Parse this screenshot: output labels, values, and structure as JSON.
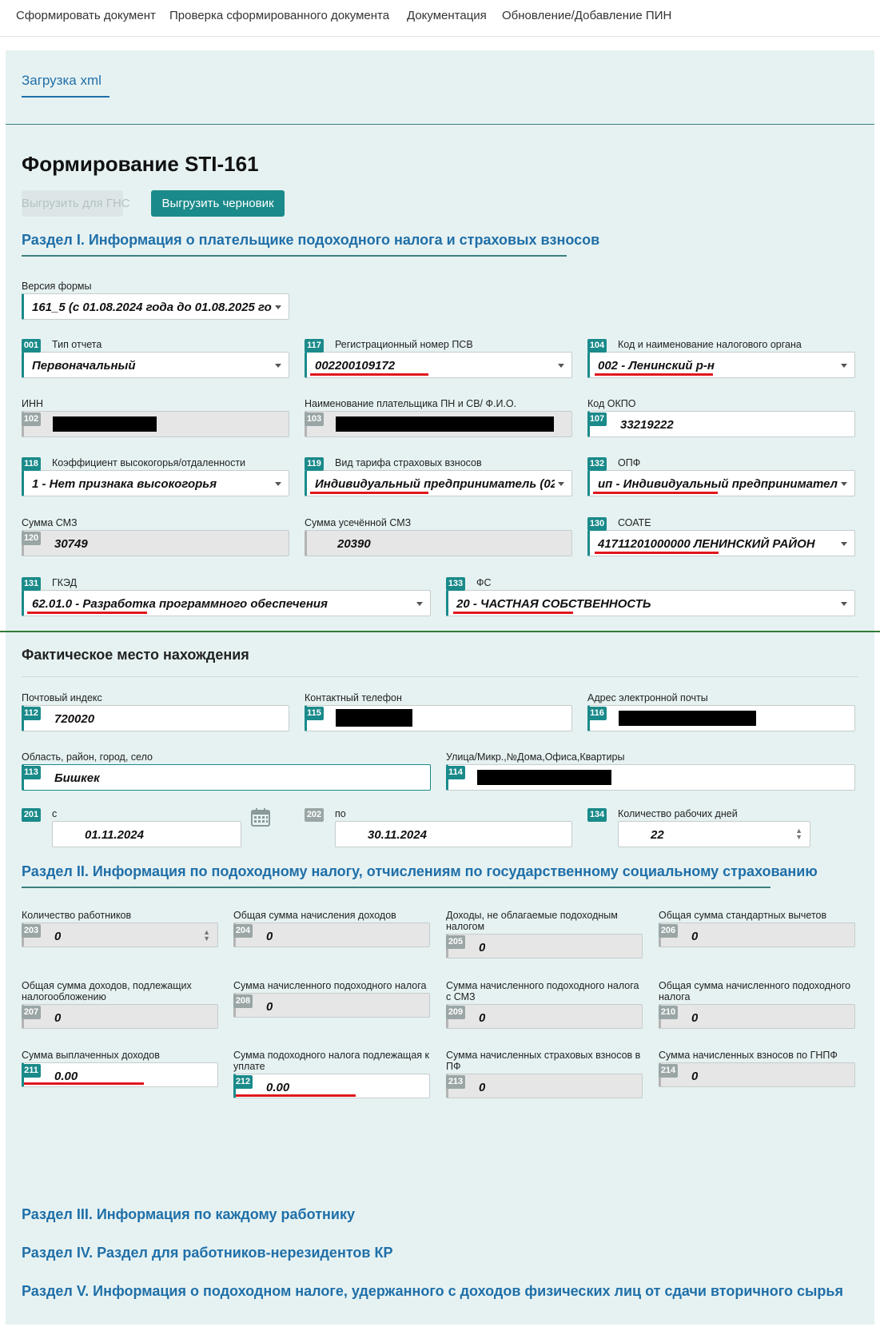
{
  "nav": {
    "items": [
      "Сформировать документ",
      "Проверка сформированного документа",
      "Документация",
      "Обновление/Добавление ПИН"
    ]
  },
  "tab": {
    "label": "Загрузка xml"
  },
  "page": {
    "title": "Формирование STI-161"
  },
  "buttons": {
    "ghns": "Выгрузить для ГНС",
    "draft": "Выгрузить черновик"
  },
  "section1": {
    "title": "Раздел I. Информация о плательщике подоходного налога и страховых взносов",
    "form_version": {
      "label": "Версия формы",
      "value": "161_5 (с 01.08.2024 года до 01.08.2025 го..."
    },
    "f001": {
      "code": "001",
      "label": "Тип отчета",
      "value": "Первоначальный"
    },
    "f117": {
      "code": "117",
      "label": "Регистрационный номер ПСВ",
      "value": "002200109172"
    },
    "f104": {
      "code": "104",
      "label": "Код и наименование налогового органа",
      "value": "002 - Ленинский р-н"
    },
    "f102": {
      "code": "102",
      "label": "ИНН"
    },
    "f103": {
      "code": "103",
      "label": "Наименование плательщика ПН и СВ/ Ф.И.О."
    },
    "f107": {
      "code": "107",
      "label": "Код ОКПО",
      "value": "33219222"
    },
    "f118": {
      "code": "118",
      "label": "Коэффициент высокогорья/отдаленности",
      "value": "1 - Нет признака высокогорья"
    },
    "f119": {
      "code": "119",
      "label": "Вид тарифа страховых взносов",
      "value": "Индивидуальный предприниматель (02.0..."
    },
    "f132": {
      "code": "132",
      "label": "ОПФ",
      "value": "ип - Индивидуальный предприниматель"
    },
    "f120": {
      "code": "120",
      "label": "Сумма СМЗ",
      "value": "30749"
    },
    "f121": {
      "label": "Сумма усечённой СМЗ",
      "value": "20390"
    },
    "f130": {
      "code": "130",
      "label": "СОАТЕ",
      "value": "41711201000000 ЛЕНИНСКИЙ РАЙОН"
    },
    "f131": {
      "code": "131",
      "label": "ГКЭД",
      "value": "62.01.0 - Разработка программного обеспечения"
    },
    "f133": {
      "code": "133",
      "label": "ФС",
      "value": "20 - ЧАСТНАЯ СОБСТВЕННОСТЬ"
    }
  },
  "location": {
    "title": "Фактическое место нахождения",
    "f112": {
      "code": "112",
      "label": "Почтовый индекс",
      "value": "720020"
    },
    "f115": {
      "code": "115",
      "label": "Контактный телефон"
    },
    "f116": {
      "code": "116",
      "label": "Адрес электронной почты"
    },
    "f113": {
      "code": "113",
      "label": "Область, район, город, село",
      "value": "Бишкек"
    },
    "f114": {
      "code": "114",
      "label": "Улица/Микр.,№Дома,Офиса,Квартиры"
    },
    "f201": {
      "code": "201",
      "label": "с",
      "value": "01.11.2024"
    },
    "f202": {
      "code": "202",
      "label": "по",
      "value": "30.11.2024"
    },
    "f134": {
      "code": "134",
      "label": "Количество рабочих дней",
      "value": "22"
    }
  },
  "section2": {
    "title": "Раздел II. Информация по подоходному налогу, отчислениям по государственному социальному страхованию",
    "f203": {
      "code": "203",
      "label": "Количество работников",
      "value": "0"
    },
    "f204": {
      "code": "204",
      "label": "Общая сумма начисления доходов",
      "value": "0"
    },
    "f205": {
      "code": "205",
      "label": "Доходы, не облагаемые подоходным налогом",
      "value": "0"
    },
    "f206": {
      "code": "206",
      "label": "Общая сумма стандартных вычетов",
      "value": "0"
    },
    "f207": {
      "code": "207",
      "label": "Общая сумма доходов, подлежащих налогообложению",
      "value": "0"
    },
    "f208": {
      "code": "208",
      "label": "Сумма начисленного подоходного налога",
      "value": "0"
    },
    "f209": {
      "code": "209",
      "label": "Сумма начисленного подоходного налога с СМЗ",
      "value": "0"
    },
    "f210": {
      "code": "210",
      "label": "Общая сумма начисленного подоходного налога",
      "value": "0"
    },
    "f211": {
      "code": "211",
      "label": "Сумма выплаченных доходов",
      "value": "0.00"
    },
    "f212": {
      "code": "212",
      "label": "Сумма подоходного налога подлежащая к уплате",
      "value": "0.00"
    },
    "f213": {
      "code": "213",
      "label": "Сумма начисленных страховых взносов в ПФ",
      "value": "0"
    },
    "f214": {
      "code": "214",
      "label": "Сумма начисленных взносов по ГНПФ",
      "value": "0"
    }
  },
  "more_sections": [
    "Раздел III. Информация по каждому работнику",
    "Раздел IV. Раздел для работников-нерезидентов КР",
    "Раздел V. Информация о подоходном налоге, удержанного с доходов физических лиц от сдачи вторичного сырья"
  ],
  "colors": {
    "teal": "#1b8a8a",
    "link": "#1f6fa8",
    "panel": "#e6f2f2",
    "underline_red": "#e0161c"
  }
}
